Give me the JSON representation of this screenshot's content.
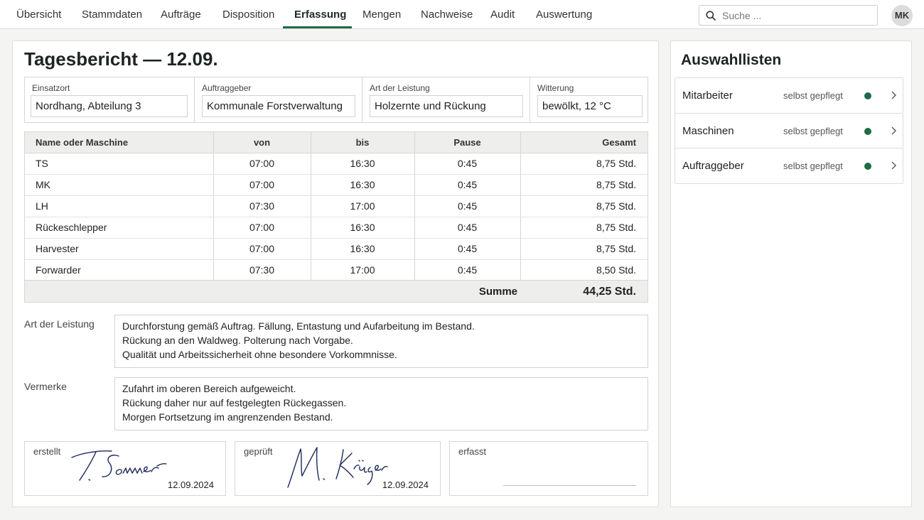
{
  "nav": {
    "tabs": [
      "Übersicht",
      "Stammdaten",
      "Aufträge",
      "Disposition",
      "Erfassung",
      "Mengen",
      "Nachweise",
      "Audit",
      "Auswertung"
    ],
    "active": "Erfassung",
    "search_placeholder": "Suche ...",
    "user_initials": "MK"
  },
  "report": {
    "title": "Tagesbericht — 12.09.",
    "meta": [
      {
        "label": "Einsatzort",
        "value": "Nordhang, Abteilung 3"
      },
      {
        "label": "Auftraggeber",
        "value": "Kommunale Forstverwaltung"
      },
      {
        "label": "Art der Leistung",
        "value": "Holzernte und Rückung"
      },
      {
        "label": "Witterung",
        "value": "bewölkt, 12 °C"
      }
    ],
    "table": {
      "headers": [
        "Name oder Maschine",
        "von",
        "bis",
        "Pause",
        "Gesamt"
      ],
      "rows": [
        [
          "TS",
          "07:00",
          "16:30",
          "0:45",
          "8,75 Std."
        ],
        [
          "MK",
          "07:00",
          "16:30",
          "0:45",
          "8,75 Std."
        ],
        [
          "LH",
          "07:30",
          "17:00",
          "0:45",
          "8,75 Std."
        ],
        [
          "Rückeschlepper",
          "07:00",
          "16:30",
          "0:45",
          "8,75 Std."
        ],
        [
          "Harvester",
          "07:00",
          "16:30",
          "0:45",
          "8,75 Std."
        ],
        [
          "Forwarder",
          "07:30",
          "17:00",
          "0:45",
          "8,50 Std."
        ]
      ],
      "sum_label": "Summe",
      "sum_value": "44,25 Std."
    },
    "leistung": {
      "label": "Art der Leistung",
      "lines": [
        "Durchforstung gemäß Auftrag. Fällung, Entastung und Aufarbeitung im Bestand.",
        "Rückung an den Waldweg. Polterung nach Vorgabe.",
        "Qualität und Arbeitssicherheit ohne besondere Vorkommnisse."
      ]
    },
    "vermerke": {
      "label": "Vermerke",
      "lines": [
        "Zufahrt im oberen Bereich aufgeweicht.",
        "Rückung daher nur auf festgelegten Rückegassen.",
        "Morgen Fortsetzung im angrenzenden Bestand."
      ]
    },
    "signatures": [
      {
        "label": "erstellt",
        "signature": "T. Sommer",
        "date": "12.09.2024"
      },
      {
        "label": "geprüft",
        "signature": "M. Krüger",
        "date": "12.09.2024"
      },
      {
        "label": "erfasst",
        "signature": "",
        "date": ""
      }
    ]
  },
  "sidebar": {
    "title": "Auswahllisten",
    "items": [
      {
        "label": "Mitarbeiter",
        "status": "selbst gepflegt",
        "status_color": "#1f6b45"
      },
      {
        "label": "Maschinen",
        "status": "selbst gepflegt",
        "status_color": "#1f6b45"
      },
      {
        "label": "Auftraggeber",
        "status": "selbst gepflegt",
        "status_color": "#1f6b45"
      }
    ]
  },
  "icons": {
    "search": "search-icon",
    "chevron": "chevron-right-icon"
  }
}
